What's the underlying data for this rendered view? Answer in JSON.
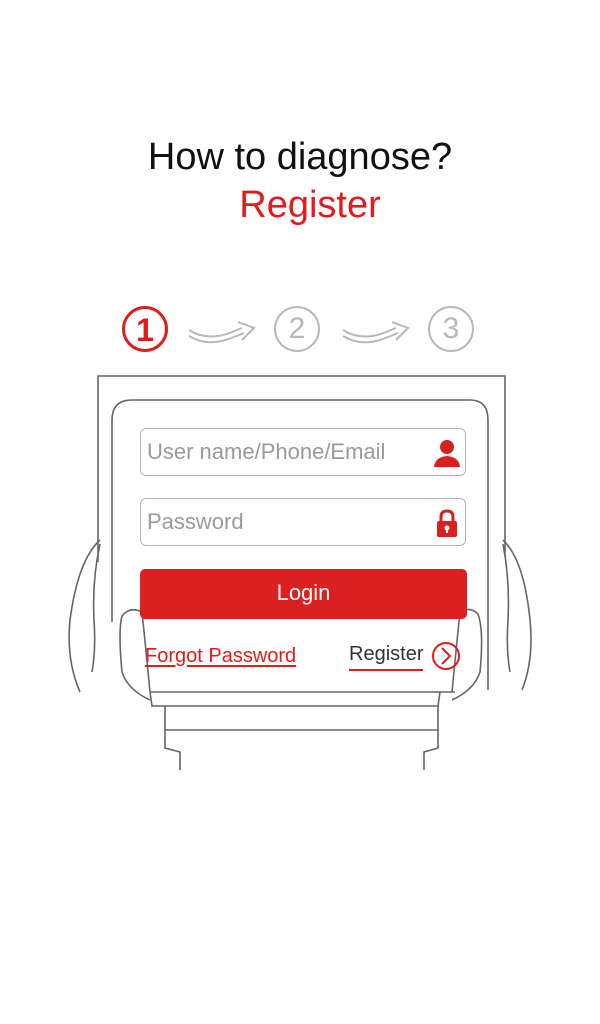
{
  "header": {
    "title": "How to diagnose?",
    "subtitle": "Register"
  },
  "steps": [
    {
      "label": "1",
      "state": "active"
    },
    {
      "label": "2",
      "state": "inactive"
    },
    {
      "label": "3",
      "state": "inactive"
    }
  ],
  "form": {
    "username_placeholder": "User name/Phone/Email",
    "username_value": "",
    "password_placeholder": "Password",
    "password_value": "",
    "login_label": "Login",
    "forgot_label": "Forgot Password",
    "register_label": "Register"
  },
  "icons": {
    "user": "user-icon",
    "lock": "lock-icon",
    "register_arrow": "chevron-right-circle-icon",
    "step_arrow": "curved-arrow-icon"
  },
  "colors": {
    "accent": "#e21b1b",
    "button": "#db2020",
    "inactive": "#b8b8b8",
    "text": "#111111"
  }
}
